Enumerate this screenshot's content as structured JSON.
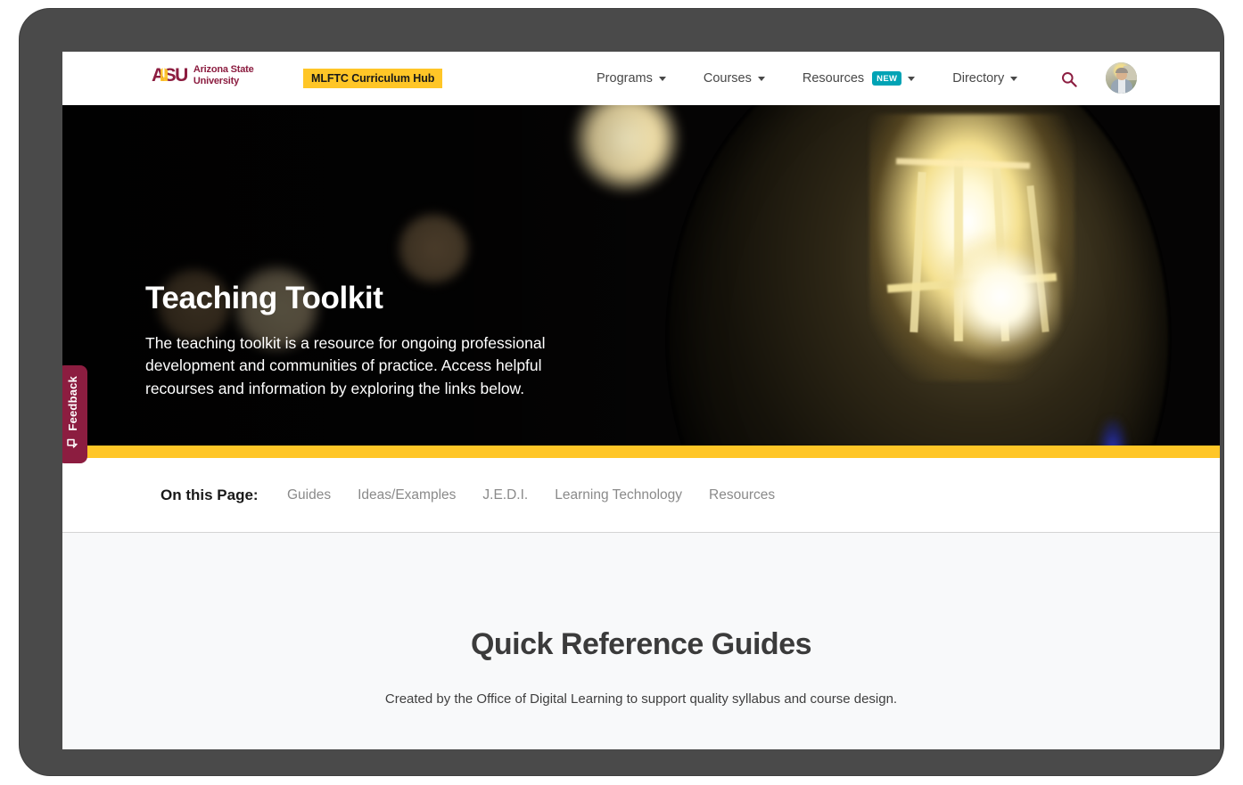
{
  "browser": {
    "device_frame_color": "#4a4a4a"
  },
  "header": {
    "logo": {
      "mark": "ASU",
      "wordmark_line1": "Arizona State",
      "wordmark_line2": "University",
      "color": "#8c1d40",
      "accent_color": "#ffc627"
    },
    "hub_badge": {
      "label": "MLFTC Curriculum Hub",
      "background": "#ffc627",
      "text_color": "#191919"
    },
    "nav_items": [
      {
        "label": "Programs",
        "has_caret": true,
        "badge": null
      },
      {
        "label": "Courses",
        "has_caret": true,
        "badge": null
      },
      {
        "label": "Resources",
        "has_caret": true,
        "badge": "NEW"
      },
      {
        "label": "Directory",
        "has_caret": true,
        "badge": null
      }
    ],
    "badge_color": "#00a3b5",
    "search_icon": "search-icon",
    "search_icon_color": "#8c1d40",
    "avatar_icon": "user-avatar"
  },
  "hero": {
    "title": "Teaching Toolkit",
    "body": "The teaching toolkit is a resource for ongoing professional development and communities of practice. Access helpful recourses and information by exploring the links below.",
    "background_image": "lightbulb-filament-photo",
    "accent_bar_color": "#ffc627"
  },
  "feedback": {
    "label": "Feedback",
    "icon": "feedback-pointer-icon",
    "background": "#8c1d40"
  },
  "on_this_page": {
    "label": "On this Page:",
    "links": [
      {
        "label": "Guides"
      },
      {
        "label": "Ideas/Examples"
      },
      {
        "label": "J.E.D.I."
      },
      {
        "label": "Learning Technology"
      },
      {
        "label": "Resources"
      }
    ],
    "link_color": "#8a8a8a"
  },
  "main": {
    "section_title": "Quick Reference Guides",
    "section_subtitle": "Created by the Office of Digital Learning to support quality syllabus and course design.",
    "background": "#f8f9fa"
  }
}
